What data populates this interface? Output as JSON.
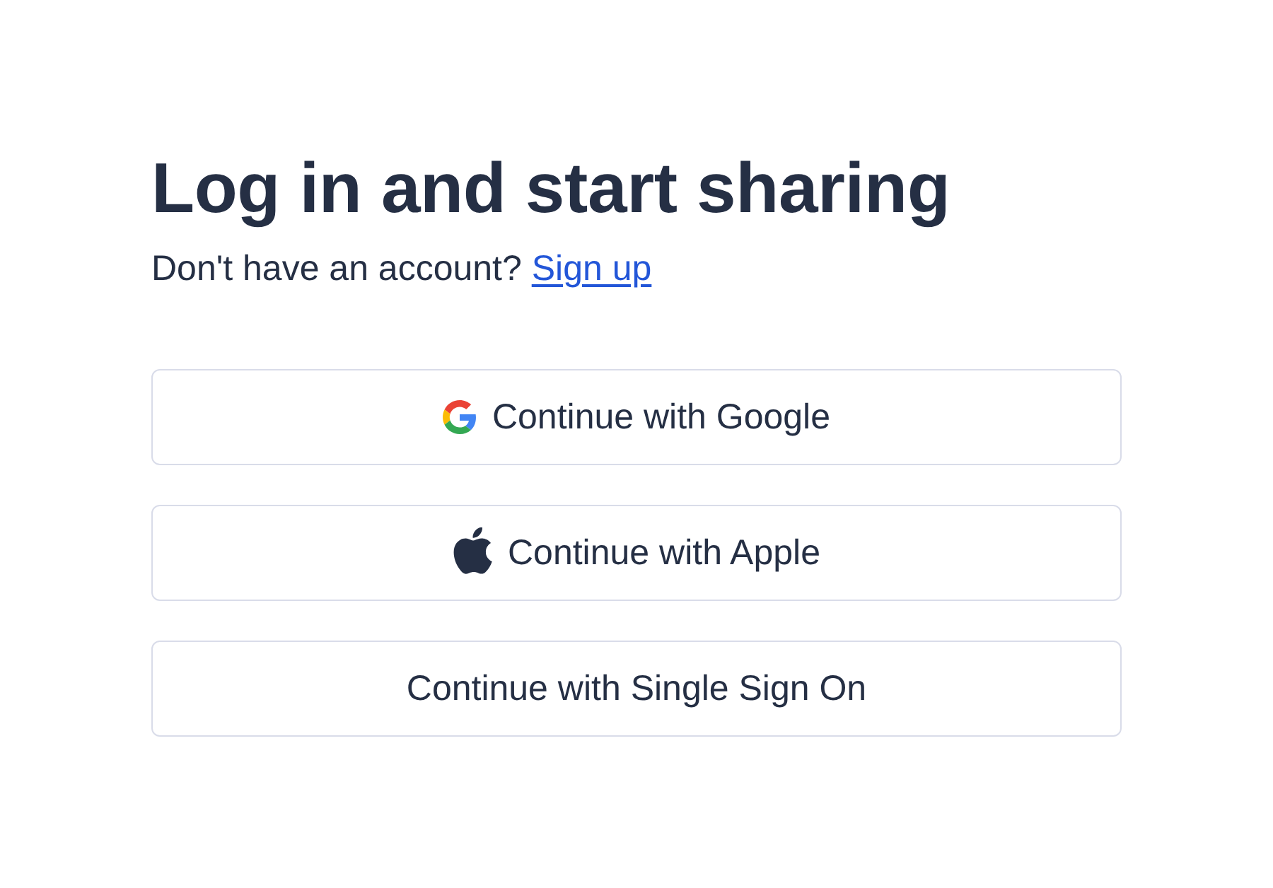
{
  "heading": "Log in and start sharing",
  "signup_prompt": {
    "text": "Don't have an account?",
    "link": "Sign up"
  },
  "buttons": [
    {
      "kind": "google",
      "label": "Continue with Google"
    },
    {
      "kind": "apple",
      "label": "Continue with Apple"
    },
    {
      "kind": "sso",
      "label": "Continue with Single Sign On"
    }
  ]
}
